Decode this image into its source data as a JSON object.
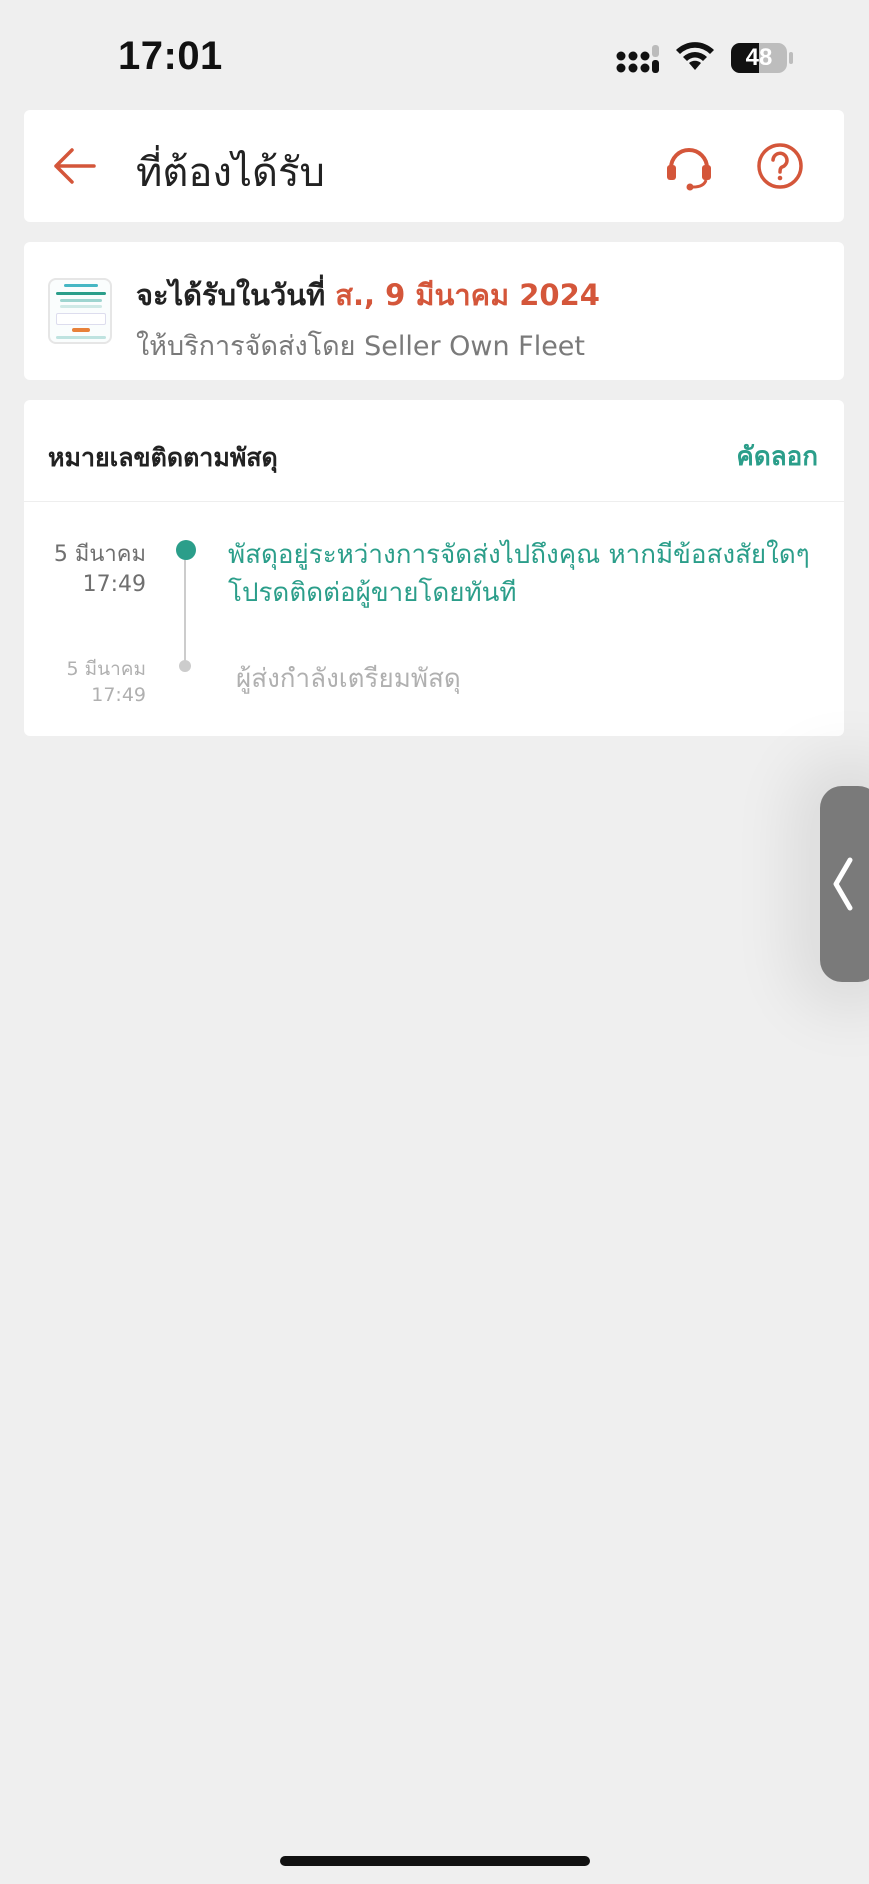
{
  "status_bar": {
    "time": "17:01",
    "battery": "48"
  },
  "header": {
    "title": "ที่ต้องได้รับ",
    "icons": [
      "back-arrow-icon",
      "customer-support-headset-icon",
      "help-question-icon"
    ]
  },
  "delivery": {
    "label": "จะได้รับในวันที่",
    "date": "ส., 9 มีนาคม 2024",
    "service": "ให้บริการจัดส่งโดย Seller Own Fleet"
  },
  "tracking": {
    "label": "หมายเลขติดตามพัสดุ",
    "copy_label": "คัดลอก",
    "events": [
      {
        "date": "5 มีนาคม",
        "time": "17:49",
        "description": "พัสดุอยู่ระหว่างการจัดส่งไปถึงคุณ หากมีข้อสงสัยใดๆ โปรดติดต่อผู้ขายโดยทันที",
        "active": true
      },
      {
        "date": "5 มีนาคม",
        "time": "17:49",
        "description": "ผู้ส่งกำลังเตรียมพัสดุ",
        "active": false
      }
    ]
  },
  "colors": {
    "accent": "#d4563a",
    "teal": "#2b9e8a",
    "muted": "#7a7a7a"
  }
}
